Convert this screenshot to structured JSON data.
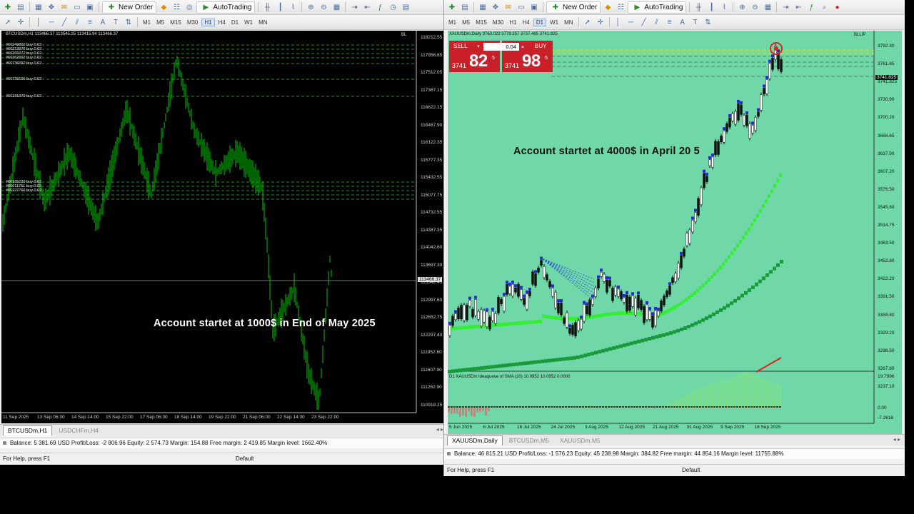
{
  "toolbar": {
    "new_order_label": "New Order",
    "autotrading_label": "AutoTrading",
    "timeframes": [
      "M1",
      "M5",
      "M15",
      "M30",
      "H1",
      "H4",
      "D1",
      "W1",
      "MN"
    ]
  },
  "left_window": {
    "chart": {
      "symbol_info": "BTCUSDm,H1  113466.37 113545.25 113415.94 113466.37",
      "corner_label": "BL",
      "price_axis": [
        "118212.55",
        "117956.85",
        "117512.05",
        "117367.15",
        "116622.15",
        "116467.90",
        "116122.35",
        "115777.35",
        "115432.55",
        "115077.75",
        "114732.55",
        "114387.35",
        "114042.60",
        "113697.30",
        "113342.45",
        "112997.60",
        "112652.75",
        "112297.40",
        "111952.60",
        "111607.90",
        "111262.90",
        "110918.25"
      ],
      "current_price": "113466.37",
      "time_axis": [
        "11 Sep 2025",
        "13 Sep 06:00",
        "14 Sep 14:00",
        "15 Sep 22:00",
        "17 Sep 06:00",
        "18 Sep 14:00",
        "19 Sep 22:00",
        "21 Sep 06:00",
        "22 Sep 14:00",
        "23 Sep 22:00"
      ],
      "orders": [
        "#66249802 buy 0.02",
        "#66213976 buy 0.02",
        "#66265972 buy 0.02",
        "#66362902 buy 0.02",
        "#66736092 buy 0.02",
        "#66739106 buy 0.02",
        "#66181979 buy 0.02",
        "#66185229 buy 0.02",
        "#66011761 buy 0.02",
        "#66227766 buy 0.02"
      ],
      "overlay_text": "Account startet at 1000$ in End of May 2025"
    },
    "tabs": [
      "BTCUSDm,H1",
      "USDCHFm,H4"
    ],
    "active_tab": 0,
    "balance_text": "Balance: 5 381.69 USD  Profit/Loss: -2 806.96  Equity: 2 574.73  Margin: 154.88  Free margin: 2 419.85  Margin level: 1662.40%",
    "status_help": "For Help, press F1",
    "status_profile": "Default",
    "colors": {
      "background": "#000000",
      "price": "#00c800",
      "order_line": "#2a8a2a"
    }
  },
  "right_window": {
    "chart": {
      "symbol_info": "XAUUSDm,Daily  3763.022 3779.257 3737.465 3741.825",
      "corner_label": "BLLIP",
      "sell_label": "SELL",
      "buy_label": "BUY",
      "volume": "0.04",
      "sell_price_prefix": "3741",
      "sell_price_big": "82",
      "sell_price_sup": "5",
      "buy_price_prefix": "3741",
      "buy_price_big": "98",
      "buy_price_sup": "5",
      "price_axis": [
        "3792.30",
        "3761.65",
        "3741.825",
        "3730.90",
        "3700.20",
        "3668.65",
        "3637.90",
        "3607.20",
        "3576.50",
        "3545.80",
        "3514.75",
        "3483.50",
        "3452.80",
        "3422.20",
        "3391.50",
        "3359.80",
        "3329.20",
        "3298.50",
        "3267.80",
        "3237.10"
      ],
      "current_price": "3741.825",
      "time_axis": [
        "5 Jun 2025",
        "6 Jul 2025",
        "16 Jul 2025",
        "24 Jul 2025",
        "3 Aug 2025",
        "12 Aug 2025",
        "21 Aug 2025",
        "31 Aug 2025",
        "9 Sep 2025",
        "18 Sep 2025"
      ],
      "overlay_text": "Account startet at 4000$ in April 20 5",
      "indicator_info": "D1 XAUUSDm Ideaqueue of SMA (20) 10.0952 10.0952 0.0000",
      "indicator_axis": [
        "19.7996",
        "0.00",
        "-7.2616"
      ],
      "colors": {
        "background": "#70d8a8",
        "trade_panel": "#c9202a",
        "ma_fast": "#33ee33",
        "ma_slow": "#1a9a3a"
      }
    },
    "tabs": [
      "XAUUSDm,Daily",
      "BTCUSDm,M5",
      "XAUUSDm,M5"
    ],
    "active_tab": 0,
    "balance_text": "Balance: 46 815.21 USD  Profit/Loss: -1 576.23  Equity: 45 238.98  Margin: 384.82  Free margin: 44 854.16  Margin level: 11755.88%",
    "status_help": "For Help, press F1",
    "status_profile": "Default"
  }
}
